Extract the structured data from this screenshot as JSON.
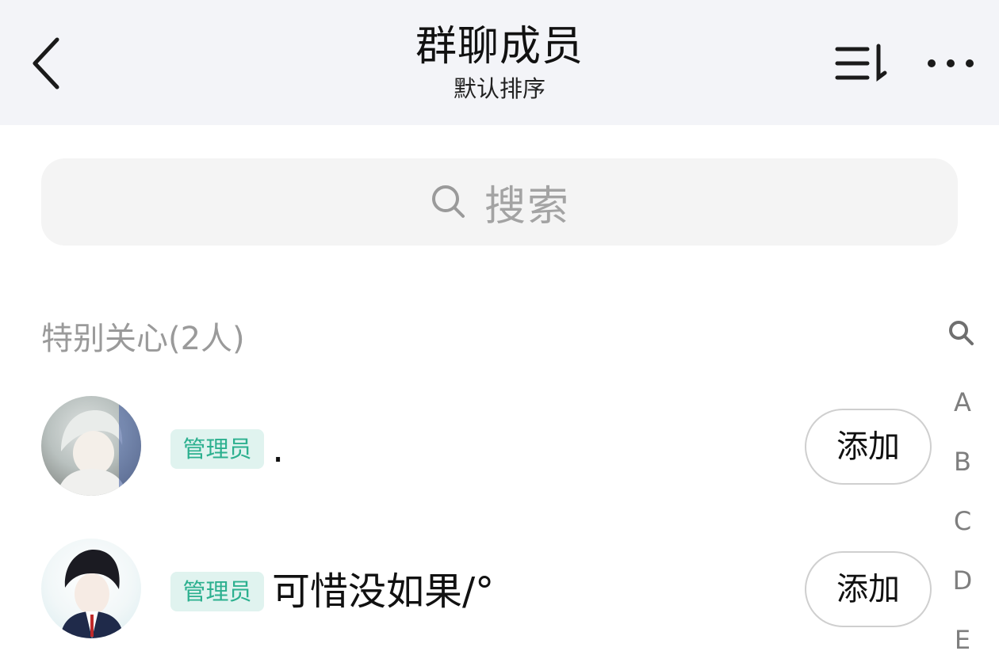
{
  "header": {
    "title": "群聊成员",
    "subtitle": "默认排序",
    "icons": {
      "back": "chevron-left-icon",
      "sort": "sort-list-icon",
      "more": "more-dots-icon"
    }
  },
  "search": {
    "placeholder": "搜索",
    "icon": "search-icon"
  },
  "section": {
    "title": "特别关心(2人)"
  },
  "members": [
    {
      "role": "管理员",
      "name": ".",
      "action": "添加"
    },
    {
      "role": "管理员",
      "name": "可惜没如果/°",
      "action": "添加"
    }
  ],
  "index": {
    "letters": [
      "A",
      "B",
      "C",
      "D",
      "E"
    ]
  },
  "colors": {
    "header_bg": "#f3f4f8",
    "badge_bg": "#e0f3ef",
    "badge_text": "#2cb08f",
    "muted_text": "#9a9a9a"
  }
}
